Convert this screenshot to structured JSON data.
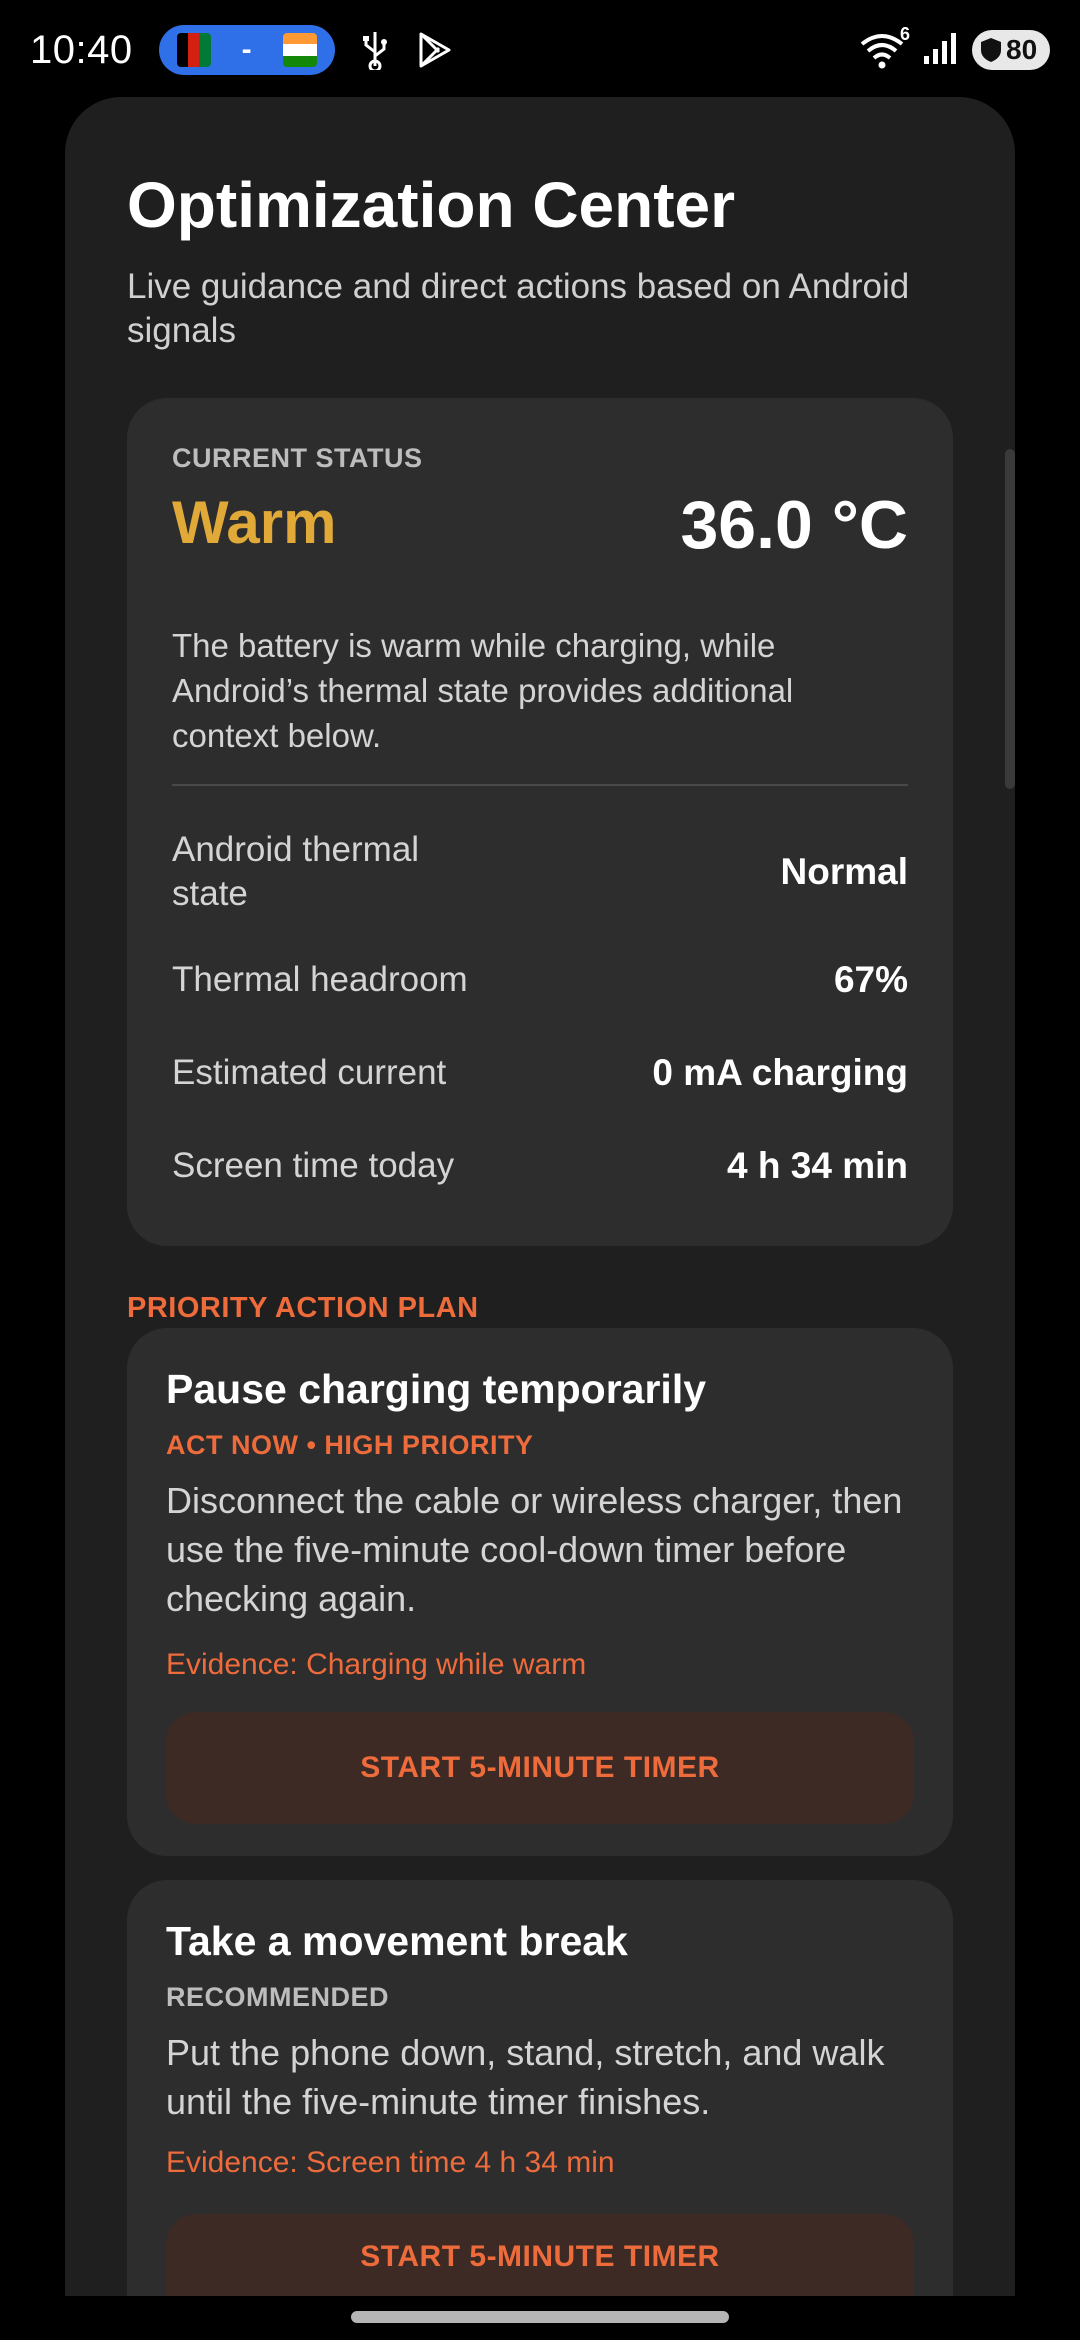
{
  "status_bar": {
    "time": "10:40",
    "pill_separator": "-",
    "signal_badge": "6",
    "battery_level": "80",
    "colors": {
      "pill": "#2f6fe8"
    }
  },
  "page": {
    "title": "Optimization Center",
    "subtitle": "Live guidance and direct actions based on Android signals"
  },
  "status_card": {
    "label": "CURRENT STATUS",
    "value": "Warm",
    "temperature": "36.0 °C",
    "description": "The battery is warm while charging, while Android’s thermal state provides additional context below.",
    "rows": [
      {
        "label": "Android thermal state",
        "value": "Normal"
      },
      {
        "label": "Thermal headroom",
        "value": "67%"
      },
      {
        "label": "Estimated current",
        "value": "0 mA charging"
      },
      {
        "label": "Screen time today",
        "value": "4 h 34 min"
      }
    ],
    "colors": {
      "warm": "#e0a938"
    }
  },
  "plan": {
    "heading": "PRIORITY ACTION PLAN",
    "actions": [
      {
        "title": "Pause charging temporarily",
        "tag": "ACT NOW • HIGH PRIORITY",
        "description": "Disconnect the cable or wireless charger, then use the five-minute cool-down timer before checking again.",
        "evidence": "Evidence: Charging while warm",
        "button": "START 5-MINUTE TIMER"
      },
      {
        "title": "Take a movement break",
        "tag": "RECOMMENDED",
        "description": "Put the phone down, stand, stretch, and walk until the five-minute timer finishes.",
        "evidence": "Evidence: Screen time 4 h 34 min",
        "button": "START 5-MINUTE TIMER"
      }
    ],
    "colors": {
      "accent": "#ee6b3c",
      "button_bg": "#3d2a24"
    }
  }
}
